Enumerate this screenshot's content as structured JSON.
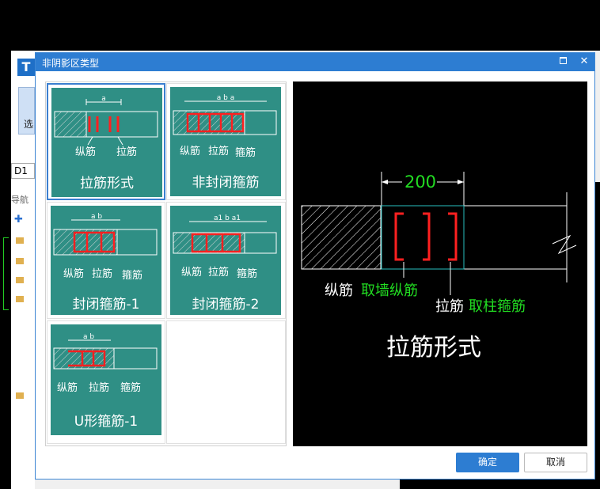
{
  "dialog": {
    "title": "非阴影区类型",
    "ok_label": "确定",
    "cancel_label": "取消"
  },
  "options": [
    {
      "label": "拉筋形式",
      "dims": "a",
      "notes": [
        "纵筋",
        "拉筋"
      ],
      "selected": true
    },
    {
      "label": "非封闭箍筋",
      "dims": "a b a",
      "notes": [
        "纵筋",
        "拉筋",
        "箍筋"
      ],
      "selected": false
    },
    {
      "label": "封闭箍筋-1",
      "dims": "a b",
      "notes": [
        "纵筋",
        "拉筋",
        "箍筋"
      ],
      "selected": false
    },
    {
      "label": "封闭箍筋-2",
      "dims": "a1 b a1",
      "notes": [
        "纵筋",
        "拉筋",
        "箍筋"
      ],
      "selected": false
    },
    {
      "label": "U形箍筋-1",
      "dims": "a b",
      "notes": [
        "纵筋",
        "拉筋",
        "箍筋"
      ],
      "selected": false
    }
  ],
  "preview": {
    "dimension": "200",
    "rebar_label_1": "纵筋",
    "rebar_note_1": "取墙纵筋",
    "rebar_label_2": "拉筋",
    "rebar_note_2": "取柱箍筋",
    "caption": "拉筋形式"
  },
  "background": {
    "logo": "T",
    "select_label": "选",
    "combo_value": "D1",
    "nav_label": "导航"
  },
  "colors": {
    "titlebar": "#2d7dd2",
    "tile": "#2f8f85",
    "rebar_red": "#ff2020",
    "note_green": "#22dd22"
  }
}
